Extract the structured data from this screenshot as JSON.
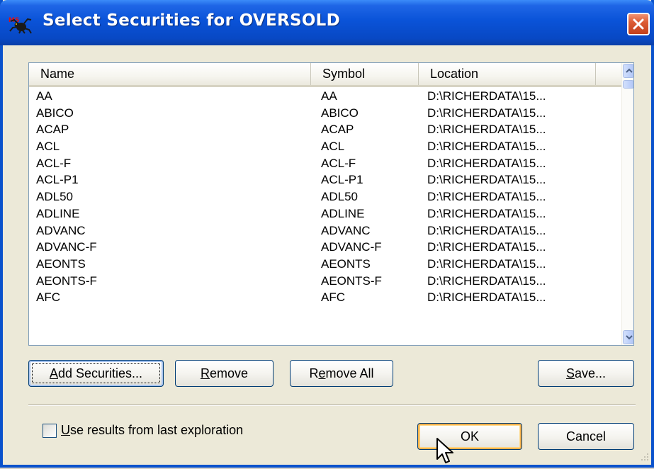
{
  "window": {
    "title": "Select Securities for OVERSOLD",
    "app_icon": "spider-app-icon",
    "close_icon": "close-icon"
  },
  "list": {
    "columns": [
      "Name",
      "Symbol",
      "Location"
    ],
    "rows": [
      {
        "name": "AA",
        "symbol": "AA",
        "location": "D:\\RICHERDATA\\15..."
      },
      {
        "name": "ABICO",
        "symbol": "ABICO",
        "location": "D:\\RICHERDATA\\15..."
      },
      {
        "name": "ACAP",
        "symbol": "ACAP",
        "location": "D:\\RICHERDATA\\15..."
      },
      {
        "name": "ACL",
        "symbol": "ACL",
        "location": "D:\\RICHERDATA\\15..."
      },
      {
        "name": "ACL-F",
        "symbol": "ACL-F",
        "location": "D:\\RICHERDATA\\15..."
      },
      {
        "name": "ACL-P1",
        "symbol": "ACL-P1",
        "location": "D:\\RICHERDATA\\15..."
      },
      {
        "name": "ADL50",
        "symbol": "ADL50",
        "location": "D:\\RICHERDATA\\15..."
      },
      {
        "name": "ADLINE",
        "symbol": "ADLINE",
        "location": "D:\\RICHERDATA\\15..."
      },
      {
        "name": "ADVANC",
        "symbol": "ADVANC",
        "location": "D:\\RICHERDATA\\15..."
      },
      {
        "name": "ADVANC-F",
        "symbol": "ADVANC-F",
        "location": "D:\\RICHERDATA\\15..."
      },
      {
        "name": "AEONTS",
        "symbol": "AEONTS",
        "location": "D:\\RICHERDATA\\15..."
      },
      {
        "name": "AEONTS-F",
        "symbol": "AEONTS-F",
        "location": "D:\\RICHERDATA\\15..."
      },
      {
        "name": "AFC",
        "symbol": "AFC",
        "location": "D:\\RICHERDATA\\15..."
      }
    ]
  },
  "buttons": {
    "add_securities": {
      "mnemonic": "A",
      "rest": "dd Securities..."
    },
    "remove": {
      "mnemonic": "R",
      "rest": "emove"
    },
    "remove_all": {
      "pre": "R",
      "mnemonic": "e",
      "rest": "move All"
    },
    "save": {
      "mnemonic": "S",
      "rest": "ave..."
    },
    "ok": "OK",
    "cancel": "Cancel"
  },
  "checkbox": {
    "mnemonic": "U",
    "rest": "se results from last exploration",
    "checked": false
  },
  "colors": {
    "titlebar": "#0a53d8",
    "window_border": "#0a52cc",
    "dialog_bg": "#ece9d8",
    "close_button": "#dc5c34"
  }
}
